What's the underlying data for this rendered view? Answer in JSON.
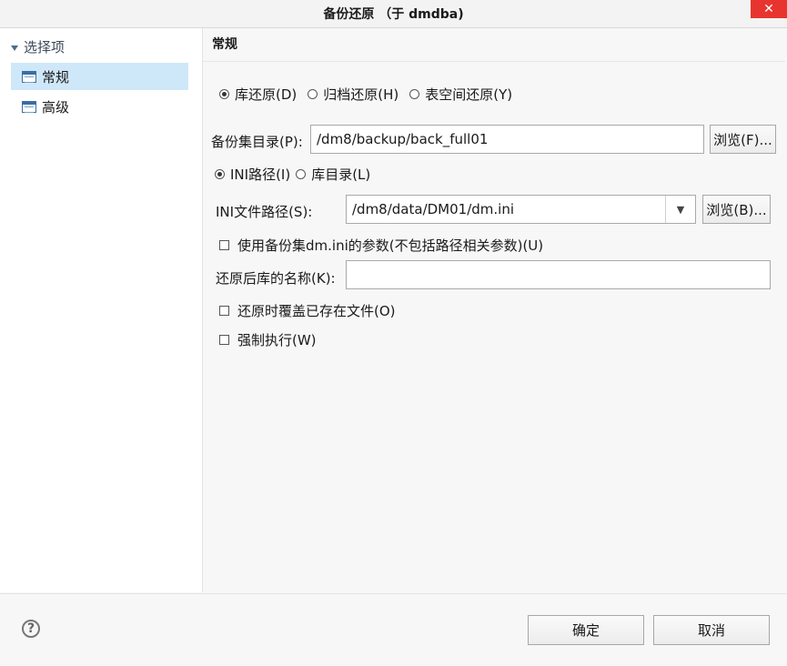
{
  "window": {
    "title": "备份还原 （于 dmdba)",
    "close_symbol": "✕"
  },
  "sidebar": {
    "header": "选择项",
    "items": [
      {
        "label": "常规",
        "active": true
      },
      {
        "label": "高级",
        "active": false
      }
    ]
  },
  "main": {
    "section_title": "常规",
    "restore_type": {
      "options": [
        "库还原(D)",
        "归档还原(H)",
        "表空间还原(Y)"
      ],
      "selected": "库还原(D)"
    },
    "backup_dir": {
      "label": "备份集目录(P):",
      "value": "/dm8/backup/back_full01",
      "browse_label": "浏览(F)..."
    },
    "source_type": {
      "options": [
        "INI路径(I)",
        "库目录(L)"
      ],
      "selected": "INI路径(I)"
    },
    "ini_path": {
      "label": "INI文件路径(S):",
      "value": "/dm8/data/DM01/dm.ini",
      "browse_label": "浏览(B)..."
    },
    "use_backup_ini": {
      "label": "使用备份集dm.ini的参数(不包括路径相关参数)(U)",
      "checked": false
    },
    "restored_name": {
      "label": "还原后库的名称(K):",
      "value": ""
    },
    "overwrite_existing": {
      "label": "还原时覆盖已存在文件(O)",
      "checked": false
    },
    "force_execute": {
      "label": "强制执行(W)",
      "checked": false
    }
  },
  "footer": {
    "ok_label": "确定",
    "cancel_label": "取消",
    "help_symbol": "?"
  },
  "colors": {
    "sidebar_active": "#cfe8f9",
    "close_button": "#e8342f"
  }
}
